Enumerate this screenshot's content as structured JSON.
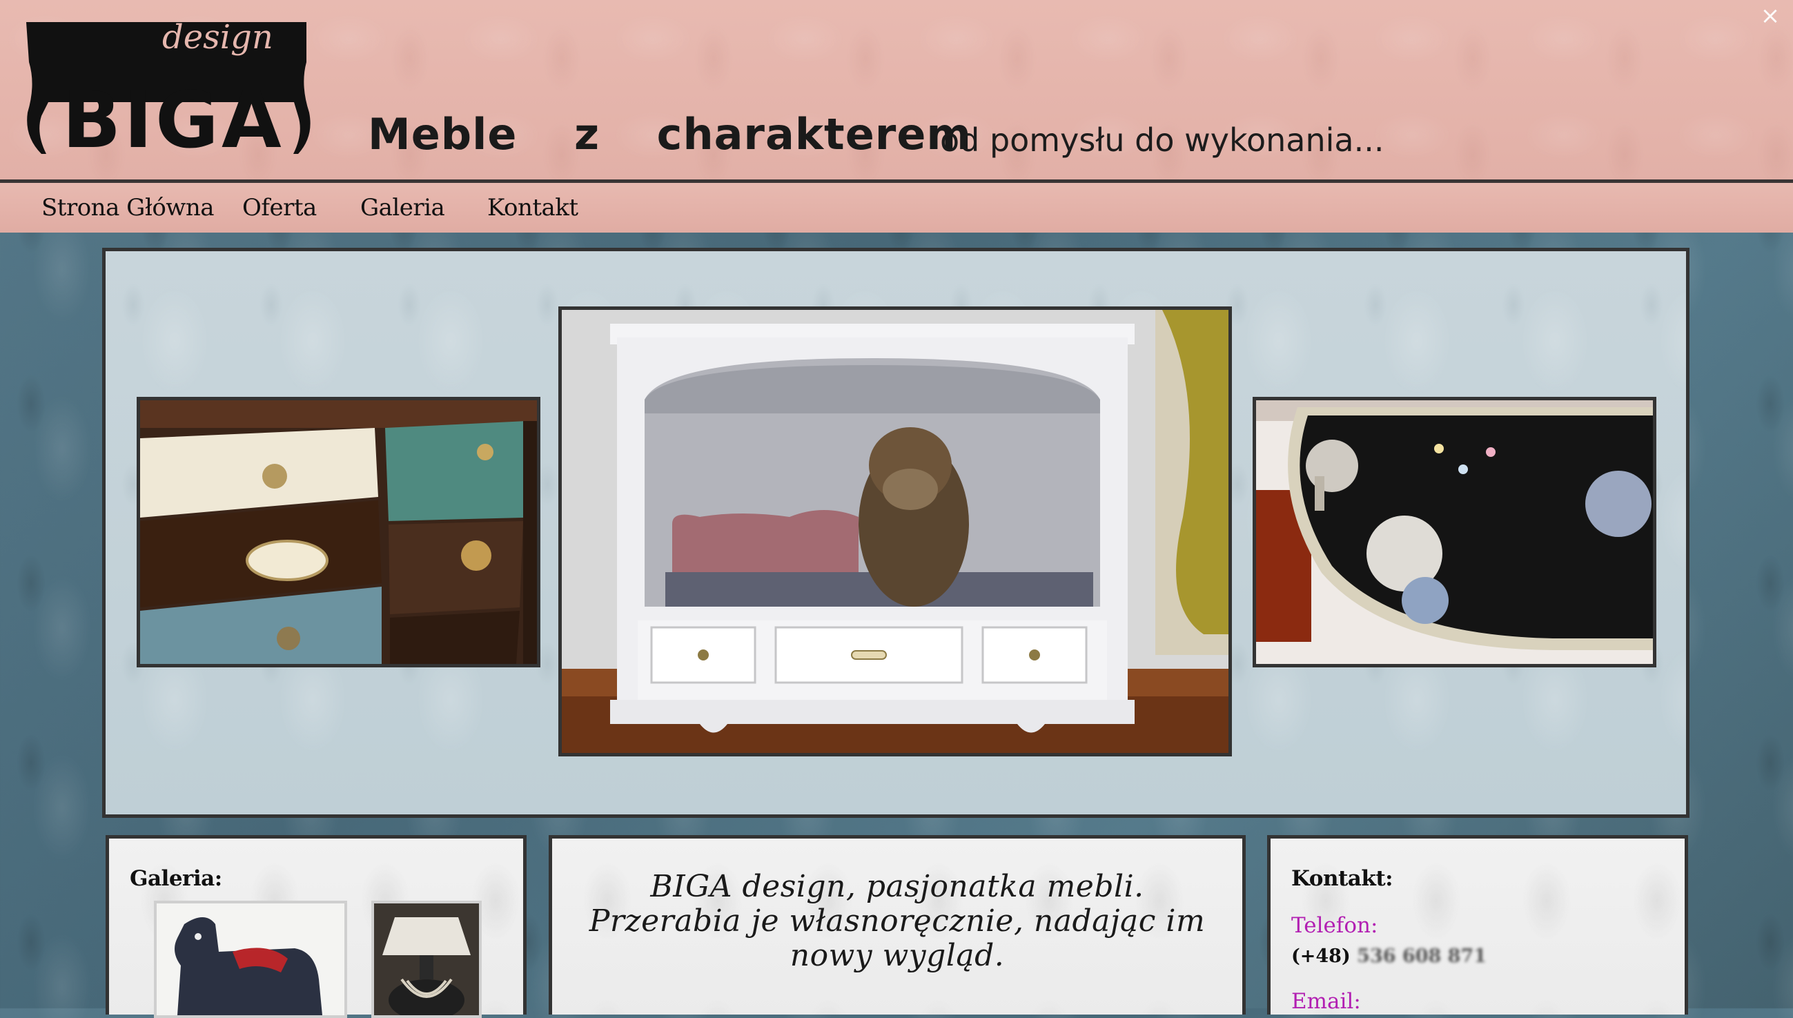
{
  "window": {
    "close_glyph": "×"
  },
  "header": {
    "logo": {
      "script": "design",
      "name": "BIGA"
    },
    "tagline": "Meble z charakterem",
    "subtagline": "od pomysłu do wykonania..."
  },
  "nav": {
    "items": [
      {
        "label": "Strona Główna"
      },
      {
        "label": "Oferta"
      },
      {
        "label": "Galeria"
      },
      {
        "label": "Kontakt"
      }
    ]
  },
  "slider": {
    "photos": [
      {
        "icon": "drawer-chest-photo"
      },
      {
        "icon": "dog-bed-cabinet-photo"
      },
      {
        "icon": "decoupage-table-photo"
      }
    ]
  },
  "gallery": {
    "title": "Galeria:",
    "thumbs": [
      {
        "icon": "horse-figurine-photo"
      },
      {
        "icon": "lamp-photo"
      }
    ]
  },
  "about": {
    "lines": [
      "BIGA design, pasjonatka mebli.",
      "Przerabia je własnoręcznie, nadając im",
      "nowy wygląd."
    ]
  },
  "contact": {
    "title": "Kontakt:",
    "phone_label": "Telefon:",
    "phone_prefix": "(+48)",
    "phone_number": "536 608 871",
    "email_label": "Email:"
  },
  "colors": {
    "header_bg": "#e6b7ae",
    "page_bg": "#4d6e7e",
    "accent_label": "#b21fb2",
    "border": "#333333"
  }
}
